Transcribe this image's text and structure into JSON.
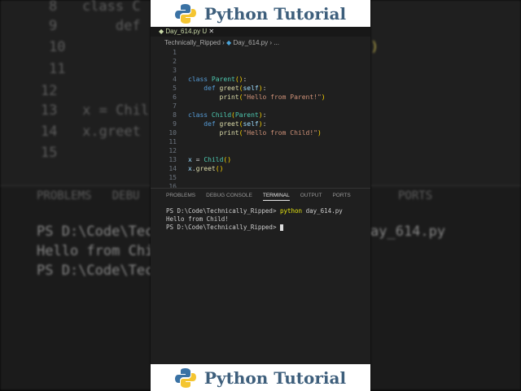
{
  "banner": {
    "title": "Python Tutorial"
  },
  "tab": {
    "filename": "Day_614.py",
    "status": "U",
    "close": "✕"
  },
  "breadcrumb": {
    "folder": "Technically_Ripped",
    "file": "Day_614.py",
    "more": "..."
  },
  "code": [
    {
      "n": "1",
      "html": ""
    },
    {
      "n": "2",
      "html": ""
    },
    {
      "n": "3",
      "html": ""
    },
    {
      "n": "4",
      "html": "<span class=kw>class</span> <span class=cls>Parent</span><span class=par>()</span><span class=w>:</span>"
    },
    {
      "n": "5",
      "html": "    <span class=kw>def</span> <span class=fn>greet</span><span class=par>(</span><span class=var>self</span><span class=par>)</span><span class=w>:</span>"
    },
    {
      "n": "6",
      "html": "        <span class=fn>print</span><span class=par>(</span><span class=str>\"Hello from Parent!\"</span><span class=par>)</span>"
    },
    {
      "n": "7",
      "html": ""
    },
    {
      "n": "8",
      "html": "<span class=kw>class</span> <span class=cls>Child</span><span class=par>(</span><span class=cls>Parent</span><span class=par>)</span><span class=w>:</span>"
    },
    {
      "n": "9",
      "html": "    <span class=kw>def</span> <span class=fn>greet</span><span class=par>(</span><span class=var>self</span><span class=par>)</span><span class=w>:</span>"
    },
    {
      "n": "10",
      "html": "        <span class=fn>print</span><span class=par>(</span><span class=str>\"Hello from Child!\"</span><span class=par>)</span>"
    },
    {
      "n": "11",
      "html": ""
    },
    {
      "n": "12",
      "html": ""
    },
    {
      "n": "13",
      "html": "<span class=var>x</span> <span class=w>=</span> <span class=cls>Child</span><span class=par>()</span>"
    },
    {
      "n": "14",
      "html": "<span class=var>x</span><span class=w>.</span><span class=fn>greet</span><span class=par>()</span>"
    },
    {
      "n": "15",
      "html": ""
    },
    {
      "n": "16",
      "html": ""
    }
  ],
  "panel": {
    "tabs": [
      "PROBLEMS",
      "DEBUG CONSOLE",
      "TERMINAL",
      "OUTPUT",
      "PORTS"
    ],
    "active": "TERMINAL"
  },
  "terminal": {
    "prompt": "PS D:\\Code\\Technically_Ripped>",
    "cmd": "python",
    "arg": "day_614.py",
    "output": "Hello from Child!"
  }
}
